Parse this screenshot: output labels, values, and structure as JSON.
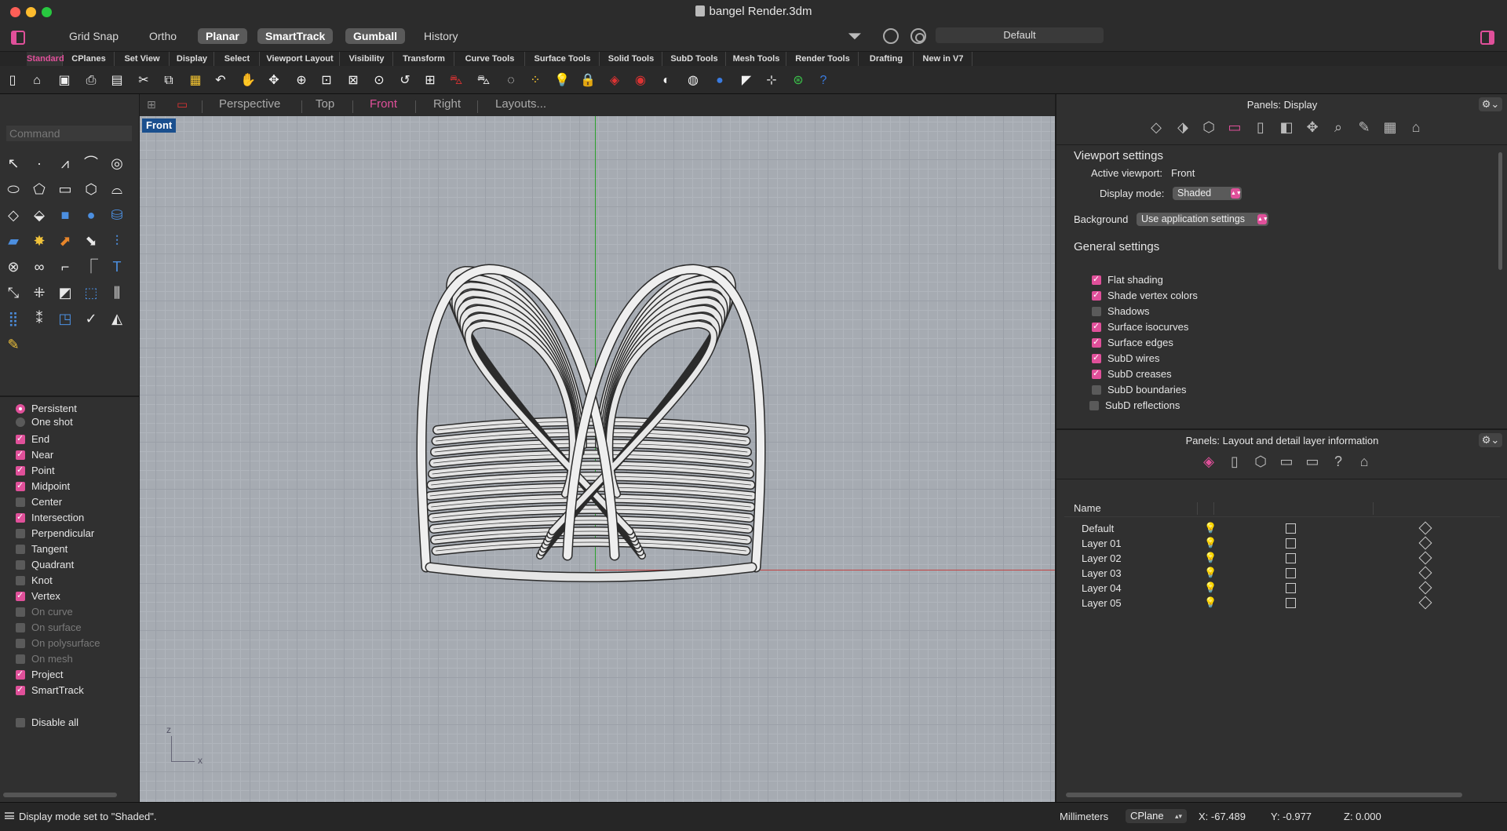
{
  "window": {
    "title": "bangel  Render.3dm"
  },
  "modebar": {
    "modes": [
      {
        "label": "Grid Snap",
        "on": false
      },
      {
        "label": "Ortho",
        "on": false
      },
      {
        "label": "Planar",
        "on": true
      },
      {
        "label": "SmartTrack",
        "on": true
      },
      {
        "label": "Gumball",
        "on": true
      },
      {
        "label": "History",
        "on": false
      }
    ],
    "current_layer": "Default"
  },
  "tabs": [
    {
      "label": "Standard",
      "active": true
    },
    {
      "label": "CPlanes"
    },
    {
      "label": "Set View"
    },
    {
      "label": "Display"
    },
    {
      "label": "Select"
    },
    {
      "label": "Viewport Layout"
    },
    {
      "label": "Visibility"
    },
    {
      "label": "Transform"
    },
    {
      "label": "Curve Tools"
    },
    {
      "label": "Surface Tools"
    },
    {
      "label": "Solid Tools"
    },
    {
      "label": "SubD Tools"
    },
    {
      "label": "Mesh Tools"
    },
    {
      "label": "Render Tools"
    },
    {
      "label": "Drafting"
    },
    {
      "label": "New in V7"
    }
  ],
  "toolbar_icons": [
    {
      "name": "new-icon",
      "glyph": "▯",
      "tone": "white"
    },
    {
      "name": "open-icon",
      "glyph": "⌂",
      "tone": "white"
    },
    {
      "name": "save-icon",
      "glyph": "▣",
      "tone": "white"
    },
    {
      "name": "print-icon",
      "glyph": "⎙",
      "tone": "white"
    },
    {
      "name": "import-icon",
      "glyph": "▤",
      "tone": "white"
    },
    {
      "name": "cut-icon",
      "glyph": "✂",
      "tone": "white"
    },
    {
      "name": "copy-icon",
      "glyph": "⧉",
      "tone": "white"
    },
    {
      "name": "paste-icon",
      "glyph": "▦",
      "tone": "yellow"
    },
    {
      "name": "undo-icon",
      "glyph": "↶",
      "tone": "white"
    },
    {
      "name": "pan-icon",
      "glyph": "✋",
      "tone": "white"
    },
    {
      "name": "rotate-view-icon",
      "glyph": "✥",
      "tone": "white"
    },
    {
      "name": "zoom-icon",
      "glyph": "⊕",
      "tone": "white"
    },
    {
      "name": "zoom-window-icon",
      "glyph": "⊡",
      "tone": "white"
    },
    {
      "name": "zoom-extents-icon",
      "glyph": "⊠",
      "tone": "white"
    },
    {
      "name": "zoom-selected-icon",
      "glyph": "⊙",
      "tone": "white"
    },
    {
      "name": "undo-view-icon",
      "glyph": "↺",
      "tone": "white"
    },
    {
      "name": "four-views-icon",
      "glyph": "⊞",
      "tone": "white"
    },
    {
      "name": "car-icon",
      "glyph": "⛍",
      "tone": "red"
    },
    {
      "name": "car-wire-icon",
      "glyph": "⛍",
      "tone": "white"
    },
    {
      "name": "select-point-icon",
      "glyph": "◌",
      "tone": "white"
    },
    {
      "name": "show-points-icon",
      "glyph": "⁘",
      "tone": "yellow"
    },
    {
      "name": "light-icon",
      "glyph": "💡",
      "tone": "white"
    },
    {
      "name": "lock-icon",
      "glyph": "🔒",
      "tone": "white"
    },
    {
      "name": "layer-icon",
      "glyph": "◈",
      "tone": "red"
    },
    {
      "name": "color-wheel-icon",
      "glyph": "◉",
      "tone": "red"
    },
    {
      "name": "shaded-sphere-icon",
      "glyph": "◐",
      "tone": "white"
    },
    {
      "name": "wire-sphere-icon",
      "glyph": "◍",
      "tone": "white"
    },
    {
      "name": "rendered-sphere-icon",
      "glyph": "●",
      "tone": "blue"
    },
    {
      "name": "render-icon",
      "glyph": "◤",
      "tone": "white"
    },
    {
      "name": "dimension-icon",
      "glyph": "⊹",
      "tone": "white"
    },
    {
      "name": "globe-icon",
      "glyph": "⊛",
      "tone": "green"
    },
    {
      "name": "help-icon",
      "glyph": "?",
      "tone": "blue"
    }
  ],
  "command": {
    "placeholder": "Command"
  },
  "left_tools": [
    {
      "name": "select-arrow-icon",
      "glyph": "↖"
    },
    {
      "name": "point-icon",
      "glyph": "·"
    },
    {
      "name": "polyline-icon",
      "glyph": "⩘"
    },
    {
      "name": "curve-icon",
      "glyph": "⌒"
    },
    {
      "name": "circle-icon",
      "glyph": "◎"
    },
    {
      "name": "ellipse-icon",
      "glyph": "⬭"
    },
    {
      "name": "polygon-icon",
      "glyph": "⬠"
    },
    {
      "name": "rectangle-icon",
      "glyph": "▭"
    },
    {
      "name": "freeform-icon",
      "glyph": "⬡"
    },
    {
      "name": "arc-icon",
      "glyph": "⌓"
    },
    {
      "name": "surface-icon",
      "glyph": "◇"
    },
    {
      "name": "extrude-icon",
      "glyph": "⬙"
    },
    {
      "name": "box-icon",
      "glyph": "■",
      "tone": "blue"
    },
    {
      "name": "sphere-icon",
      "glyph": "●",
      "tone": "blue"
    },
    {
      "name": "cylinder-icon",
      "glyph": "⛁",
      "tone": "blue"
    },
    {
      "name": "plane-icon",
      "glyph": "▰",
      "tone": "blue"
    },
    {
      "name": "explode-icon",
      "glyph": "✸",
      "tone": "yellow"
    },
    {
      "name": "trim-icon",
      "glyph": "⬈",
      "tone": "orange"
    },
    {
      "name": "split-icon",
      "glyph": "⬊"
    },
    {
      "name": "offset-icon",
      "glyph": "⫶",
      "tone": "blue"
    },
    {
      "name": "boolean-icon",
      "glyph": "⊗"
    },
    {
      "name": "group-icon",
      "glyph": "∞"
    },
    {
      "name": "fillet-icon",
      "glyph": "⌐"
    },
    {
      "name": "chamfer-icon",
      "glyph": "⎾"
    },
    {
      "name": "text-icon",
      "glyph": "T",
      "tone": "blue"
    },
    {
      "name": "scale-icon",
      "glyph": "⤡"
    },
    {
      "name": "move-icon",
      "glyph": "⁜"
    },
    {
      "name": "mirror-icon",
      "glyph": "◩"
    },
    {
      "name": "array-icon",
      "glyph": "⬚",
      "tone": "blue"
    },
    {
      "name": "align-icon",
      "glyph": "⫼"
    },
    {
      "name": "grid-array-icon",
      "glyph": "⣿",
      "tone": "blue"
    },
    {
      "name": "dimension-tool-icon",
      "glyph": "⁑"
    },
    {
      "name": "properties-icon",
      "glyph": "◳",
      "tone": "blue"
    },
    {
      "name": "check-icon",
      "glyph": "✓"
    },
    {
      "name": "analyze-icon",
      "glyph": "◭"
    },
    {
      "name": "pencil-icon",
      "glyph": "✎",
      "tone": "yellow"
    }
  ],
  "osnap": {
    "persistent_label": "Persistent",
    "oneshot_label": "One shot",
    "mode": "persistent",
    "items": [
      {
        "label": "End",
        "checked": true
      },
      {
        "label": "Near",
        "checked": true
      },
      {
        "label": "Point",
        "checked": true
      },
      {
        "label": "Midpoint",
        "checked": true
      },
      {
        "label": "Center",
        "checked": false
      },
      {
        "label": "Intersection",
        "checked": true
      },
      {
        "label": "Perpendicular",
        "checked": false
      },
      {
        "label": "Tangent",
        "checked": false
      },
      {
        "label": "Quadrant",
        "checked": false
      },
      {
        "label": "Knot",
        "checked": false
      },
      {
        "label": "Vertex",
        "checked": true
      },
      {
        "label": "On curve",
        "checked": false,
        "dim": true
      },
      {
        "label": "On surface",
        "checked": false,
        "dim": true
      },
      {
        "label": "On polysurface",
        "checked": false,
        "dim": true
      },
      {
        "label": "On mesh",
        "checked": false,
        "dim": true
      },
      {
        "label": "Project",
        "checked": true
      },
      {
        "label": "SmartTrack",
        "checked": true
      }
    ],
    "disable_all": "Disable all"
  },
  "viewport_tabs": [
    {
      "label": "Perspective",
      "active": false
    },
    {
      "label": "Top",
      "active": false
    },
    {
      "label": "Front",
      "active": true
    },
    {
      "label": "Right",
      "active": false
    },
    {
      "label": "Layouts...",
      "active": false
    }
  ],
  "viewport": {
    "label": "Front",
    "axis_z": "z",
    "axis_x": "x"
  },
  "display_panel": {
    "title": "Panels: Display",
    "tab_icons": [
      "layers-icon",
      "objects-icon",
      "cube-icon",
      "display-icon",
      "page-icon",
      "render-icon",
      "target-icon",
      "lasso-icon",
      "pen-icon",
      "checker-icon",
      "folder-icon"
    ],
    "viewport_settings": "Viewport settings",
    "active_viewport_label": "Active viewport:",
    "active_viewport": "Front",
    "display_mode_label": "Display mode:",
    "display_mode": "Shaded",
    "background_label": "Background",
    "background": "Use application settings",
    "general_settings": "General settings",
    "general": [
      {
        "label": "Flat shading",
        "checked": true
      },
      {
        "label": "Shade vertex colors",
        "checked": true
      },
      {
        "label": "Shadows",
        "checked": false
      },
      {
        "label": "Surface isocurves",
        "checked": true
      },
      {
        "label": "Surface edges",
        "checked": true
      },
      {
        "label": "SubD wires",
        "checked": true
      },
      {
        "label": "SubD creases",
        "checked": true
      },
      {
        "label": "SubD boundaries",
        "checked": false
      },
      {
        "label": "SubD reflections",
        "checked": false
      }
    ]
  },
  "layout_panel": {
    "title": "Panels: Layout and detail layer information",
    "tab_icons": [
      "layout-layers-icon",
      "page-icon",
      "cube-icon",
      "sheet-icon",
      "monitor-icon",
      "help-icon",
      "folder-icon"
    ],
    "name_header": "Name",
    "layers": [
      {
        "name": "Default"
      },
      {
        "name": "Layer 01"
      },
      {
        "name": "Layer 02"
      },
      {
        "name": "Layer 03"
      },
      {
        "name": "Layer 04"
      },
      {
        "name": "Layer 05"
      }
    ]
  },
  "status": {
    "message": "Display mode set to \"Shaded\".",
    "units": "Millimeters",
    "cplane": "CPlane",
    "x": "X: -67.489",
    "y": "Y: -0.977",
    "z": "Z: 0.000"
  }
}
